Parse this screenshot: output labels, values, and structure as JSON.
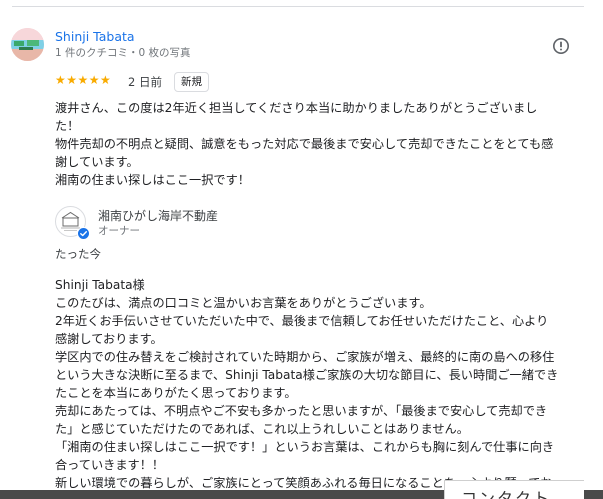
{
  "review": {
    "reviewer_name": "Shinji Tabata",
    "reviewer_meta": "1 件のクチコミ・0 枚の写真",
    "stars": "★★★★★",
    "rating": 5,
    "date": "2 日前",
    "badge": "新規",
    "text_lines": [
      "渡井さん、この度は2年近く担当してくださり本当に助かりましたありがとうございまし",
      "た！",
      "物件売却の不明点と疑問、誠意をもった対応で最後まで安心して売却できたことをとても感",
      "謝しています。",
      "湘南の住まい探しはここ一択です！"
    ]
  },
  "owner_reply": {
    "owner_name": "湘南ひがし海岸不動産",
    "owner_role": "オーナー",
    "time": "たった今",
    "text_lines": [
      "Shinji Tabata様",
      "このたびは、満点の口コミと温かいお言葉をありがとうございます。",
      "2年近くお手伝いさせていただいた中で、最後まで信頼してお任せいただけたこと、心より",
      "感謝しております。",
      "学区内での住み替えをご検討されていた時期から、ご家族が増え、最終的に南の島への移住",
      "という大きな決断に至るまで、Shinji Tabata様ご家族の大切な節目に、長い時間ご一緒でき",
      "たことを本当にありがたく思っております。",
      "売却にあたっては、不明点やご不安も多かったと思いますが、「最後まで安心して売却でき",
      "た」と感じていただけたのであれば、これ以上うれしいことはありません。",
      "「湘南の住まい探しはここ一択です！」というお言葉は、これからも胸に刻んで仕事に向き",
      "合っていきます！！",
      "新しい環境での暮らしが、ご家族にとって笑顔あふれる毎日になることを、心より願ってお"
    ]
  },
  "contact_tab": {
    "label": "コンタクト"
  },
  "colors": {
    "link_blue": "#1a73e8",
    "star_gold": "#f9ab00",
    "verified_blue": "#1a73e8"
  },
  "icons": {
    "report": "report-flag-icon",
    "verified": "verified-check-icon"
  }
}
